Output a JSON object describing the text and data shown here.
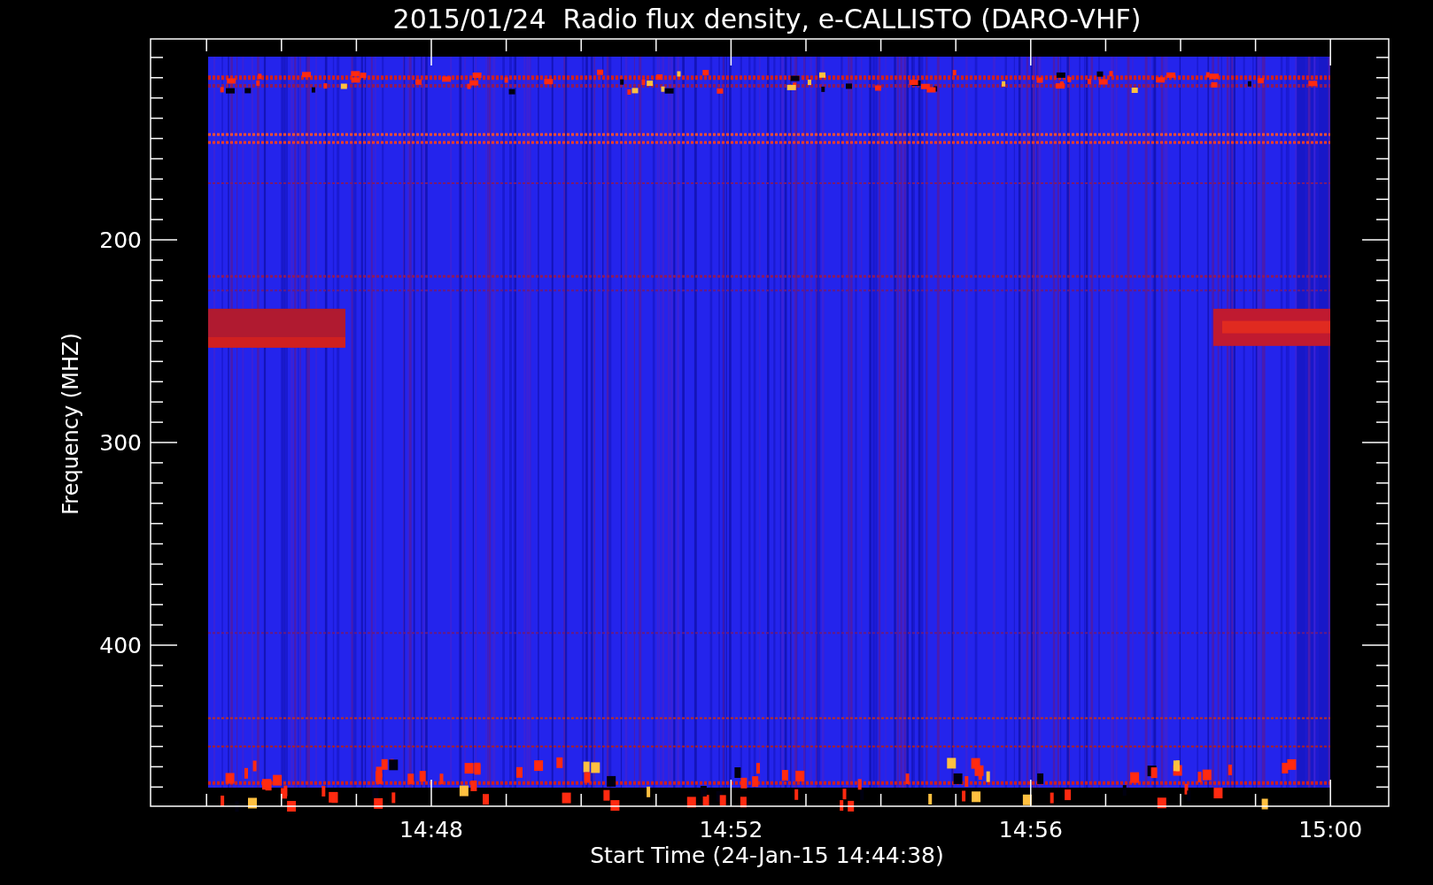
{
  "title": "2015/01/24  Radio flux density, e-CALLISTO (DARO-VHF)",
  "y_axis": {
    "label": "Frequency (MHZ)",
    "ticks": [
      "200",
      "300",
      "400"
    ]
  },
  "x_axis": {
    "label": "Start Time (24-Jan-15 14:44:38)",
    "ticks": [
      "14:48",
      "14:52",
      "14:56",
      "15:00"
    ]
  }
}
